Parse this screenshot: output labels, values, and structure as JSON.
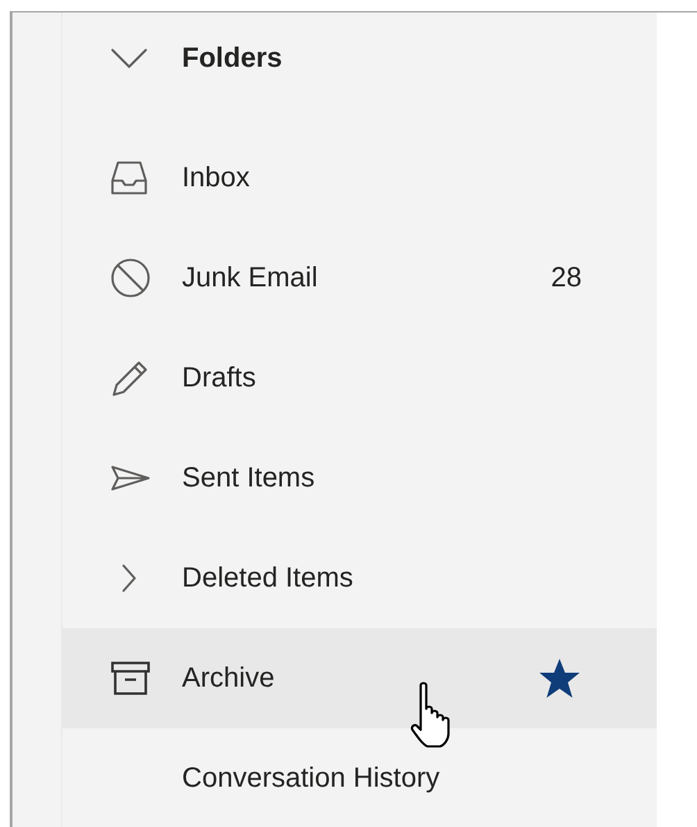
{
  "header": {
    "label": "Folders",
    "expanded": true
  },
  "folders": [
    {
      "kind": "inbox",
      "label": "Inbox",
      "hovered": false,
      "favorite": false
    },
    {
      "kind": "junk",
      "label": "Junk Email",
      "count": "28",
      "hovered": false,
      "favorite": false
    },
    {
      "kind": "drafts",
      "label": "Drafts",
      "hovered": false,
      "favorite": false
    },
    {
      "kind": "sent",
      "label": "Sent Items",
      "hovered": false,
      "favorite": false
    },
    {
      "kind": "expander",
      "label": "Deleted Items",
      "expanded": false,
      "hovered": false,
      "favorite": false
    },
    {
      "kind": "archive",
      "label": "Archive",
      "hovered": true,
      "favorite": true
    },
    {
      "kind": "plain",
      "label": "Conversation History",
      "hovered": false,
      "favorite": false
    }
  ]
}
